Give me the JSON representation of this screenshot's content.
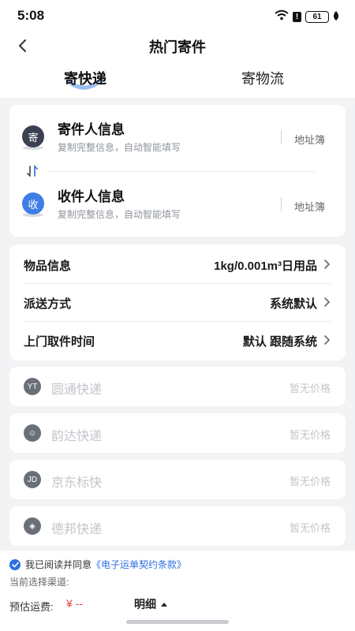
{
  "status_bar": {
    "time": "5:08",
    "battery": "61"
  },
  "nav": {
    "title": "热门寄件"
  },
  "tabs": [
    {
      "label": "寄快递",
      "active": true
    },
    {
      "label": "寄物流",
      "active": false
    }
  ],
  "sender": {
    "badge": "寄",
    "title": "寄件人信息",
    "subtitle": "复制完整信息，自动智能填写",
    "address_book": "地址簿"
  },
  "receiver": {
    "badge": "收",
    "title": "收件人信息",
    "subtitle": "复制完整信息，自动智能填写",
    "address_book": "地址簿"
  },
  "info_rows": [
    {
      "label": "物品信息",
      "value": "1kg/0.001m³日用品"
    },
    {
      "label": "派送方式",
      "value": "系统默认"
    },
    {
      "label": "上门取件时间",
      "value": "默认 跟随系统"
    }
  ],
  "carriers": [
    {
      "name": "圆通快递",
      "price": "暂无价格",
      "icon": "yto-logo-icon"
    },
    {
      "name": "韵达快递",
      "price": "暂无价格",
      "icon": "yunda-logo-icon"
    },
    {
      "name": "京东标快",
      "price": "暂无价格",
      "icon": "jd-logo-icon"
    },
    {
      "name": "德邦快递",
      "price": "暂无价格",
      "icon": "deppon-logo-icon"
    }
  ],
  "bottom": {
    "agree_prefix": "我已阅读并同意",
    "agree_link": "《电子运单契约条款》",
    "channel_label": "当前选择渠道:",
    "fee_label": "预估运费:",
    "fee_value": "¥ --",
    "detail_label": "明细"
  },
  "colors": {
    "accent": "#2d6fe0",
    "price_red": "#e64545",
    "sender_badge": "#3a4150",
    "receiver_badge": "#3f7de6"
  }
}
